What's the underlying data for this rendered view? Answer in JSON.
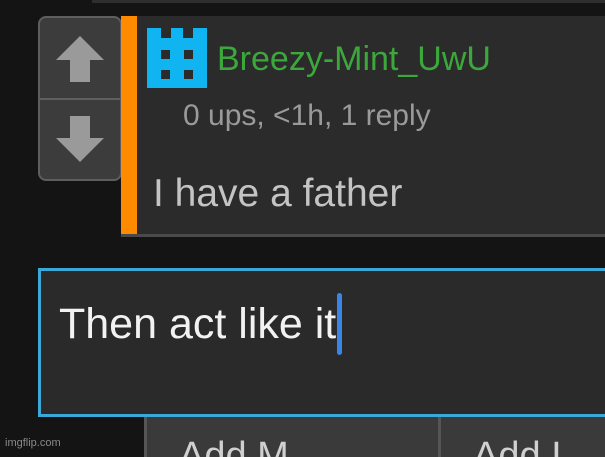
{
  "comment": {
    "username": "Breezy-Mint_UwU",
    "meta": "0 ups, <1h, 1 reply",
    "body": "I have a father",
    "avatar_icon": "pixel-cat-avatar-icon",
    "accent_color": "#ff8a00",
    "username_color": "#3ca83c"
  },
  "votes": {
    "up_icon": "arrow-up-icon",
    "down_icon": "arrow-down-icon"
  },
  "reply": {
    "value": "Then act like it",
    "border_color": "#3aa8d8"
  },
  "buttons": {
    "add_meme_label": "Add M",
    "add_image_label": "Add I"
  },
  "watermark": "imgflip.com"
}
